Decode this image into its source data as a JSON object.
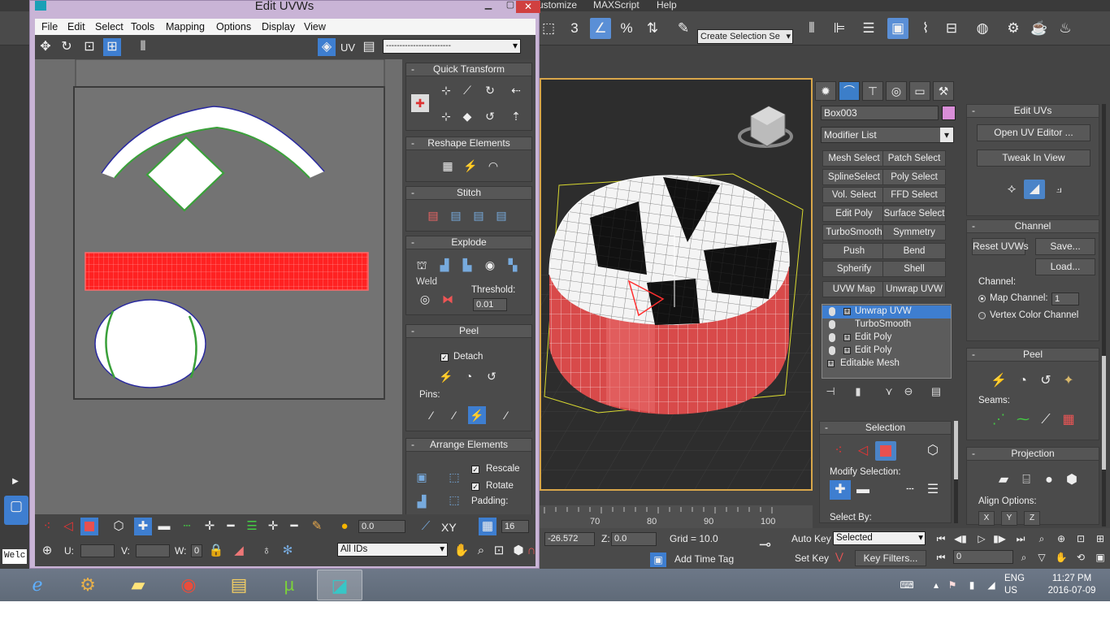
{
  "max_app": {
    "menus": [
      "ustomize",
      "MAXScript",
      "Help"
    ],
    "selection_set_placeholder": "Create Selection Se",
    "snap_labels": [
      "3",
      "%"
    ],
    "listener_text": "Welc"
  },
  "command_panel": {
    "object_name": "Box003",
    "object_color": "#d98ed8",
    "modifier_list_label": "Modifier List",
    "modifier_buttons": [
      "Mesh Select",
      "Patch Select",
      "SplineSelect",
      "Poly Select",
      "Vol. Select",
      "FFD Select",
      "Edit Poly",
      "Surface Select",
      "TurboSmooth",
      "Symmetry",
      "Push",
      "Bend",
      "Spherify",
      "Shell",
      "UVW Map",
      "Unwrap UVW"
    ],
    "stack": [
      "Unwrap UVW",
      "TurboSmooth",
      "Edit Poly",
      "Edit Poly",
      "Editable Mesh"
    ],
    "selection_rollout": {
      "title": "Selection",
      "modify_selection_label": "Modify Selection:",
      "select_by_label": "Select By:"
    }
  },
  "edit_uvs_rollout": {
    "title": "Edit UVs",
    "open_uv_editor": "Open UV Editor ...",
    "tweak_in_view": "Tweak In View"
  },
  "channel_rollout": {
    "title": "Channel",
    "reset_uvws": "Reset UVWs",
    "save": "Save...",
    "load": "Load...",
    "channel_label": "Channel:",
    "map_channel_label": "Map Channel:",
    "map_channel_value": "1",
    "vertex_color_channel_label": "Vertex Color Channel"
  },
  "peel_rollout_right": {
    "title": "Peel",
    "seams_label": "Seams:"
  },
  "projection_rollout": {
    "title": "Projection",
    "align_options_label": "Align Options:",
    "align_buttons": [
      "X",
      "Y",
      "Z"
    ]
  },
  "timeline": {
    "ticks": [
      "70",
      "80",
      "90",
      "100"
    ]
  },
  "status_bar": {
    "x_value": "-26.572",
    "z_label": "Z:",
    "z_value": "0.0",
    "grid_label": "Grid = 10.0",
    "add_time_tag": "Add Time Tag",
    "auto_key": "Auto Key",
    "set_key": "Set Key",
    "key_mode_value": "Selected",
    "key_filters": "Key Filters...",
    "frame_value": "0"
  },
  "uvw_window": {
    "title": "Edit UVWs",
    "menus": [
      "File",
      "Edit",
      "Select",
      "Tools",
      "Mapping",
      "Options",
      "Display",
      "View"
    ],
    "uv_label": "UV",
    "map_dropdown_value": "------------------------",
    "quick_transform": {
      "title": "Quick Transform"
    },
    "reshape_elements": {
      "title": "Reshape Elements"
    },
    "stitch": {
      "title": "Stitch"
    },
    "explode": {
      "title": "Explode",
      "weld_label": "Weld",
      "threshold_label": "Threshold:",
      "threshold_value": "0.01"
    },
    "peel": {
      "title": "Peel",
      "detach_label": "Detach",
      "detach_checked": true,
      "pins_label": "Pins:"
    },
    "arrange_elements": {
      "title": "Arrange Elements",
      "rescale_label": "Rescale",
      "rescale_checked": true,
      "rotate_label": "Rotate",
      "rotate_checked": true,
      "padding_label": "Padding:"
    },
    "bottom": {
      "spin_value": "0.0",
      "xy_label": "XY",
      "grid_value": "16",
      "u_label": "U:",
      "v_label": "V:",
      "w_label": "W:",
      "w_value": "0",
      "ids_value": "All IDs"
    }
  },
  "taskbar": {
    "language_line1": "ENG",
    "language_line2": "US",
    "time": "11:27 PM",
    "date": "2016-07-09"
  }
}
